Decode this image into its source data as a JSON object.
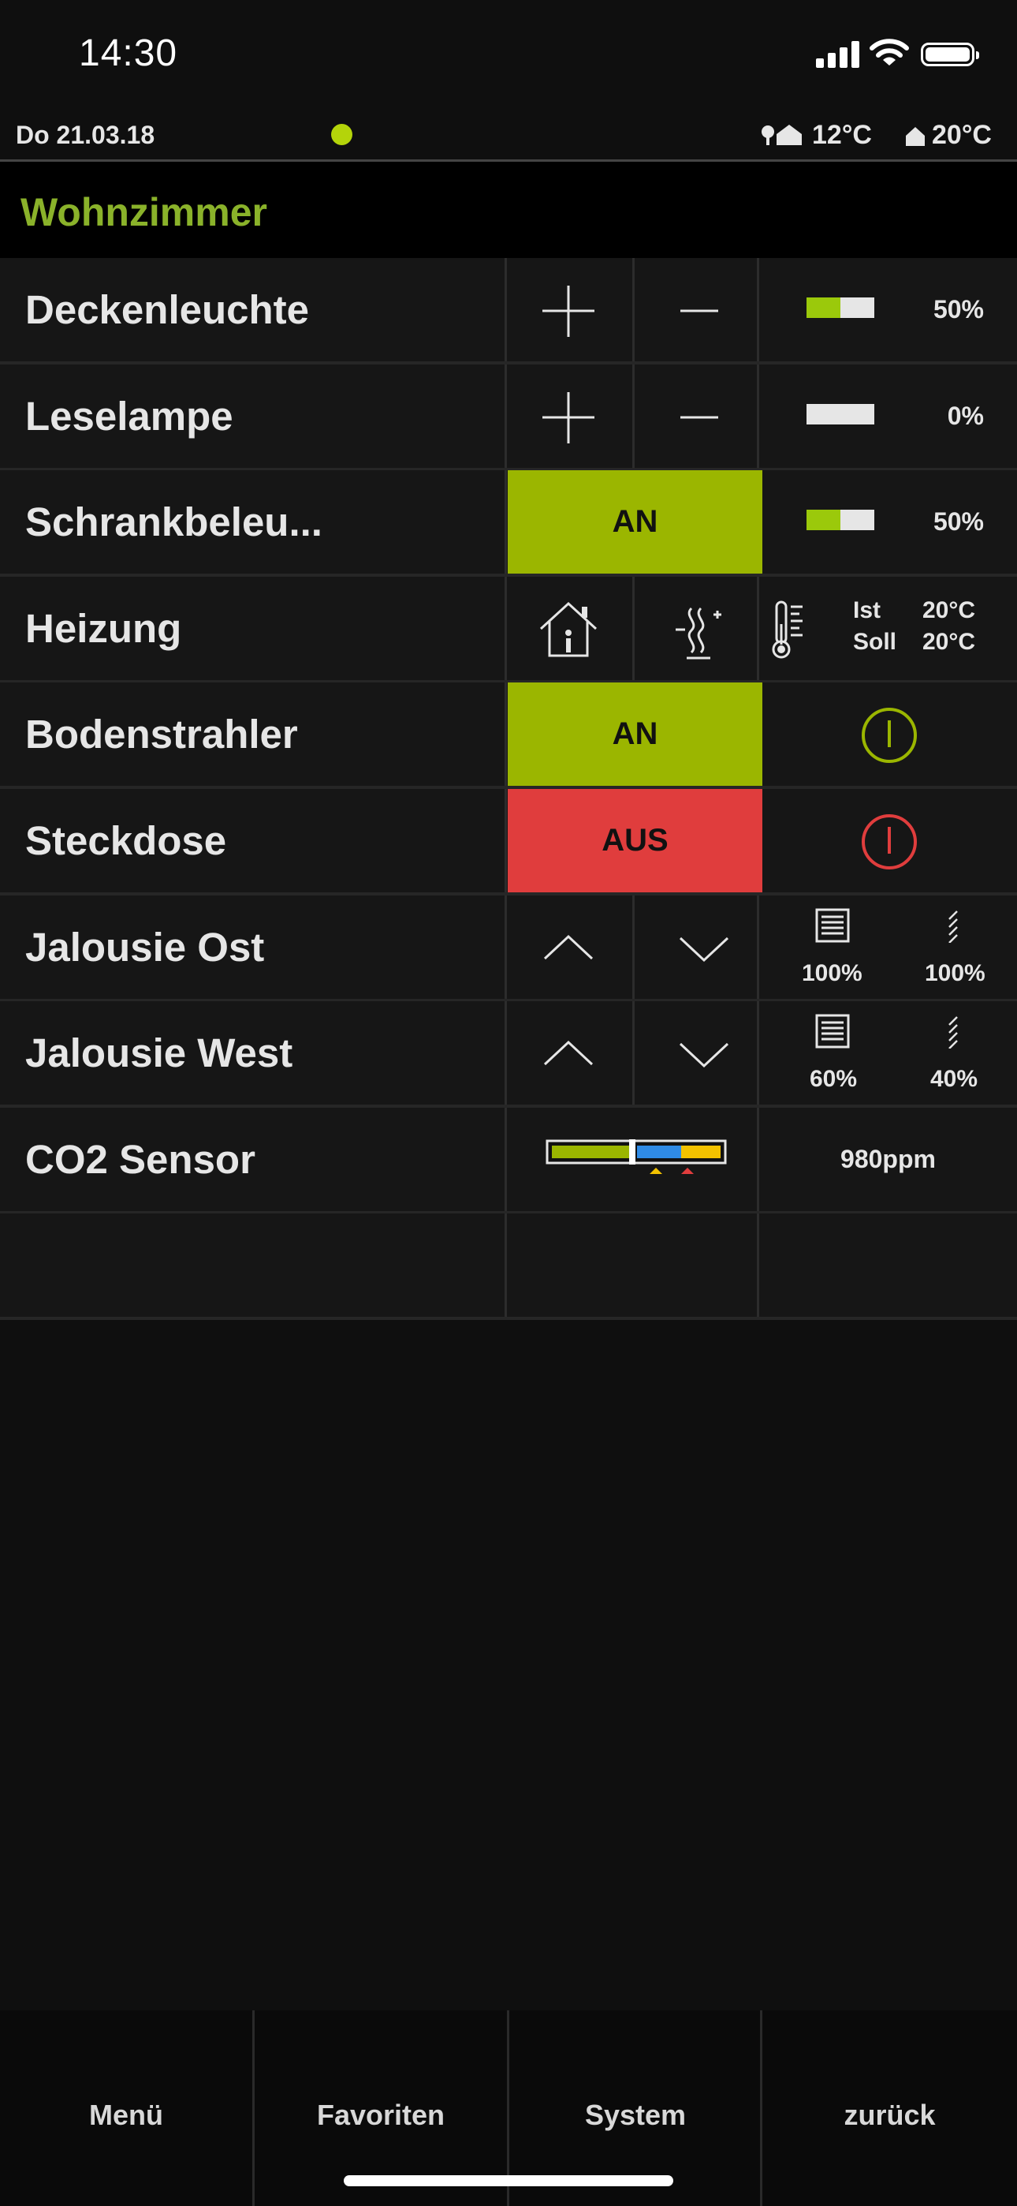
{
  "status_bar": {
    "time": "14:30",
    "icons": [
      "cellular-signal-icon",
      "wifi-icon",
      "battery-icon"
    ]
  },
  "info_bar": {
    "date": "Do 21.03.18",
    "connection_dot_color": "#b4d40a",
    "outdoor_temp": "12°C",
    "indoor_temp": "20°C"
  },
  "room": {
    "title": "Wohnzimmer",
    "title_color": "#8ab22a"
  },
  "rows": [
    {
      "label": "Deckenleuchte",
      "type": "dimmer",
      "value": "50%",
      "level": 0.5
    },
    {
      "label": "Leselampe",
      "type": "dimmer",
      "value": "0%",
      "level": 0
    },
    {
      "label": "Schrankbeleu...",
      "type": "switch-dimmer",
      "button": "AN",
      "value": "50%",
      "level": 0.5
    },
    {
      "label": "Heizung",
      "type": "heating",
      "ist_label": "Ist",
      "ist_value": "20°C",
      "soll_label": "Soll",
      "soll_value": "20°C"
    },
    {
      "label": "Bodenstrahler",
      "type": "switch",
      "button": "AN",
      "state": "on"
    },
    {
      "label": "Steckdose",
      "type": "switch",
      "button": "AUS",
      "state": "off"
    },
    {
      "label": "Jalousie Ost",
      "type": "blind",
      "position": "100%",
      "slat": "100%"
    },
    {
      "label": "Jalousie West",
      "type": "blind",
      "position": "60%",
      "slat": "40%"
    },
    {
      "label": "CO2 Sensor",
      "type": "sensor",
      "value": "980ppm"
    }
  ],
  "tabs": [
    "Menü",
    "Favoriten",
    "System",
    "zurück"
  ],
  "colors": {
    "on": "#9bb600",
    "off": "#e03d3d",
    "accent": "#b4d40a"
  }
}
